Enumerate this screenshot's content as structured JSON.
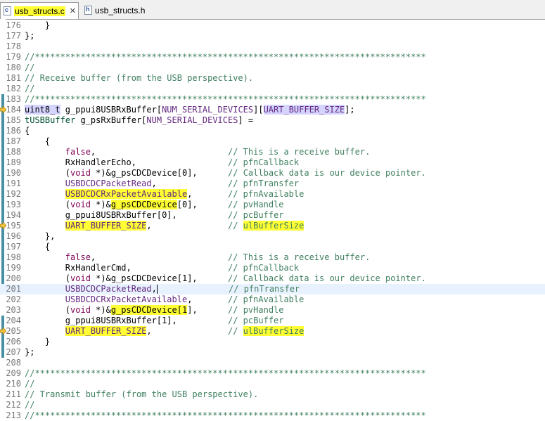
{
  "tabs": [
    {
      "label": "usb_structs.c",
      "icon": "c-file-icon",
      "active": true
    },
    {
      "label": "usb_structs.h",
      "icon": "h-file-icon",
      "active": false
    }
  ],
  "tab_close_glyph": "✕",
  "colors": {
    "highlight": "#ffff33",
    "comment": "#3f7f5f",
    "macro": "#642880",
    "type": "#005032",
    "line_number": "#787878"
  },
  "lines": [
    {
      "n": "176",
      "t": "    }"
    },
    {
      "n": "177",
      "t": "};"
    },
    {
      "n": "178",
      "t": ""
    },
    {
      "n": "179",
      "t": "//*****************************************************************************"
    },
    {
      "n": "180",
      "t": "//"
    },
    {
      "n": "181",
      "t": "// Receive buffer (from the USB perspective)."
    },
    {
      "n": "182",
      "t": "//"
    },
    {
      "n": "183",
      "t": "//*****************************************************************************"
    },
    {
      "n": "184",
      "t": "uint8_t g_ppui8USBRxBuffer[NUM_SERIAL_DEVICES][UART_BUFFER_SIZE];"
    },
    {
      "n": "185",
      "t": "tUSBBuffer g_psRxBuffer[NUM_SERIAL_DEVICES] ="
    },
    {
      "n": "186",
      "t": "{"
    },
    {
      "n": "187",
      "t": "    {"
    },
    {
      "n": "188",
      "t": "        false,                          // This is a receive buffer."
    },
    {
      "n": "189",
      "t": "        RxHandlerEcho,                  // pfnCallback"
    },
    {
      "n": "190",
      "t": "        (void *)&g_psCDCDevice[0],      // Callback data is our device pointer."
    },
    {
      "n": "191",
      "t": "        USBDCDCPacketRead,              // pfnTransfer"
    },
    {
      "n": "192",
      "t": "        USBDCDCRxPacketAvailable,       // pfnAvailable"
    },
    {
      "n": "193",
      "t": "        (void *)&g_psCDCDevice[0],      // pvHandle"
    },
    {
      "n": "194",
      "t": "        g_ppui8USBRxBuffer[0],          // pcBuffer"
    },
    {
      "n": "195",
      "t": "        UART_BUFFER_SIZE,               // ulBufferSize"
    },
    {
      "n": "196",
      "t": "    },"
    },
    {
      "n": "197",
      "t": "    {"
    },
    {
      "n": "198",
      "t": "        false,                          // This is a receive buffer."
    },
    {
      "n": "199",
      "t": "        RxHandlerCmd,                   // pfnCallback"
    },
    {
      "n": "200",
      "t": "        (void *)&g_psCDCDevice[1],      // Callback data is our device pointer."
    },
    {
      "n": "201",
      "t": "        USBDCDCPacketRead,              // pfnTransfer"
    },
    {
      "n": "202",
      "t": "        USBDCDCRxPacketAvailable,       // pfnAvailable"
    },
    {
      "n": "203",
      "t": "        (void *)&g_psCDCDevice[1],      // pvHandle"
    },
    {
      "n": "204",
      "t": "        g_ppui8USBRxBuffer[1],          // pcBuffer"
    },
    {
      "n": "205",
      "t": "        UART_BUFFER_SIZE,               // ulBufferSize"
    },
    {
      "n": "206",
      "t": "    }"
    },
    {
      "n": "207",
      "t": "};"
    },
    {
      "n": "208",
      "t": ""
    },
    {
      "n": "209",
      "t": "//*****************************************************************************"
    },
    {
      "n": "210",
      "t": "//"
    },
    {
      "n": "211",
      "t": "// Transmit buffer (from the USB perspective)."
    },
    {
      "n": "212",
      "t": "//"
    },
    {
      "n": "213",
      "t": "//*****************************************************************************"
    }
  ]
}
